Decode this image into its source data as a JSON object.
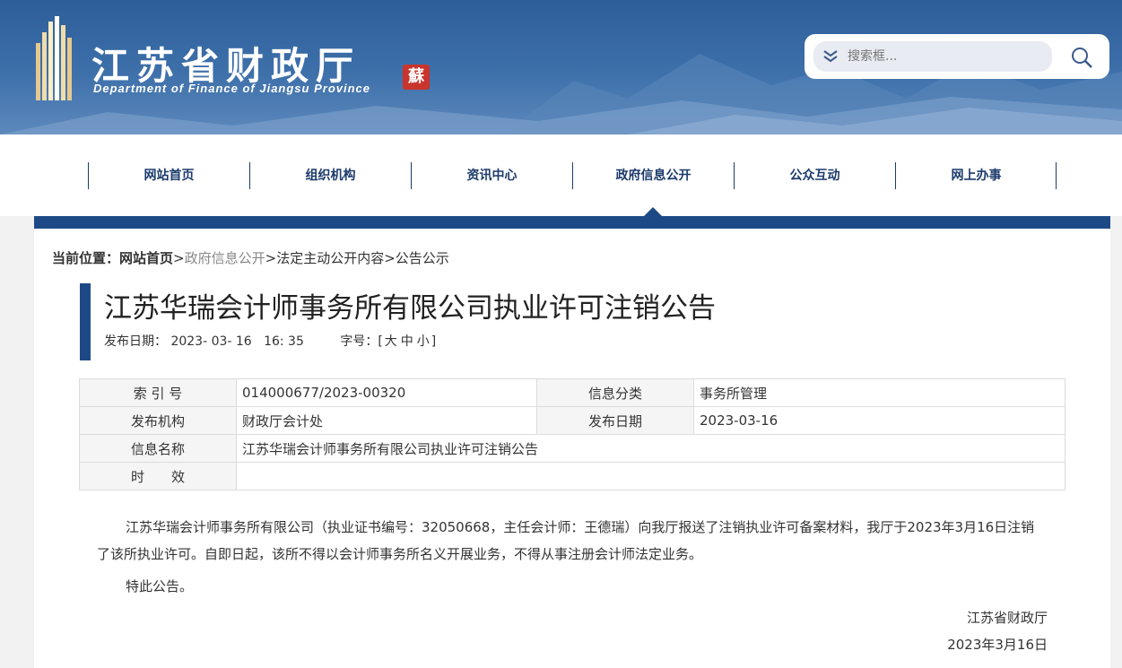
{
  "header": {
    "site_title": "江苏省财政厅",
    "site_subtitle": "Department of Finance of Jiangsu Province",
    "seal_char": "蘇",
    "search_placeholder": "搜索框...",
    "icons": [
      "building-logo-icon",
      "chevron-down-icon",
      "search-icon"
    ]
  },
  "nav": {
    "items": [
      {
        "label": "网站首页"
      },
      {
        "label": "组织机构"
      },
      {
        "label": "资讯中心"
      },
      {
        "label": "政府信息公开"
      },
      {
        "label": "公众互动"
      },
      {
        "label": "网上办事"
      }
    ],
    "active_index": 3
  },
  "breadcrumb": {
    "label": "当前位置：",
    "home": "网站首页",
    "sep": ">",
    "items": [
      "政府信息公开",
      "法定主动公开内容",
      "公告公示"
    ]
  },
  "article": {
    "title": "江苏华瑞会计师事务所有限公司执业许可注销公告",
    "date_label": "发布日期：",
    "date_value": "2023- 03- 16   16: 35",
    "font_label": "字号：[",
    "font_large": "大",
    "font_medium": "中",
    "font_small": "小",
    "font_close": "]"
  },
  "info_table": {
    "index_label": "索 引 号",
    "index_value": "014000677/2023-00320",
    "category_label": "信息分类",
    "category_value": "事务所管理",
    "org_label": "发布机构",
    "org_value": "财政厅会计处",
    "pubdate_label": "发布日期",
    "pubdate_value": "2023-03-16",
    "name_label": "信息名称",
    "name_value": "江苏华瑞会计师事务所有限公司执业许可注销公告",
    "validity_label": "时　　效",
    "validity_value": ""
  },
  "body": {
    "para1": "江苏华瑞会计师事务所有限公司（执业证书编号：32050668，主任会计师：王德瑞）向我厅报送了注销执业许可备案材料，我厅于2023年3月16日注销了该所执业许可。自即日起，该所不得以会计师事务所名义开展业务，不得从事注册会计师法定业务。",
    "para2": "特此公告。",
    "signer": "江苏省财政厅",
    "sign_date": "2023年3月16日"
  },
  "colors": {
    "brand_blue": "#1d4a86",
    "nav_text": "#1b3a6b",
    "seal_red": "#c9342c"
  }
}
